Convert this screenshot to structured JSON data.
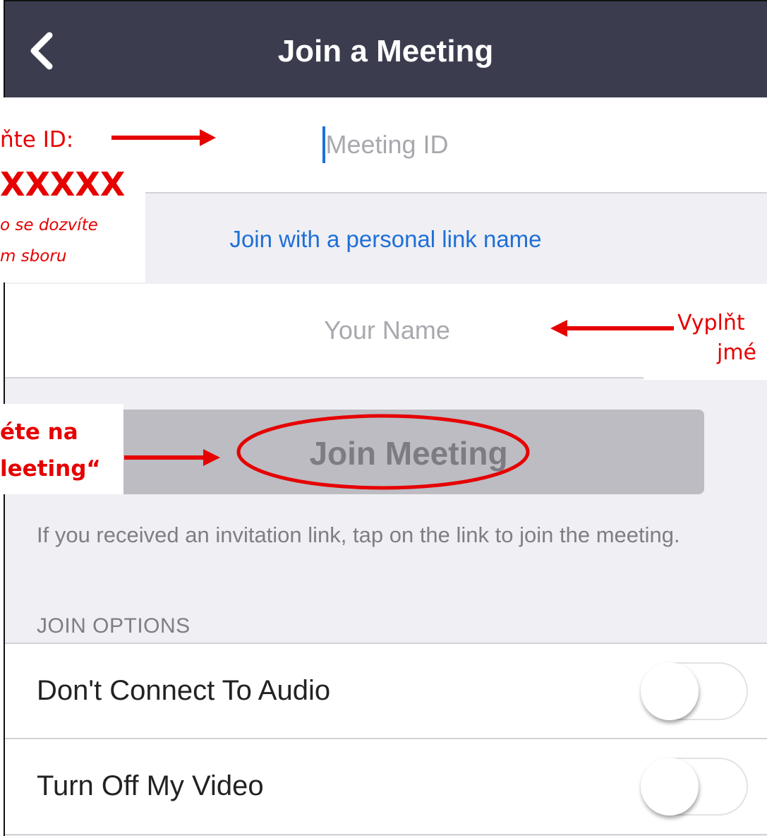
{
  "nav": {
    "title": "Join a Meeting",
    "back_icon": "chevron-left-icon"
  },
  "meeting_id": {
    "value": "",
    "placeholder": "Meeting ID"
  },
  "personal_link": {
    "label": "Join with a personal link name"
  },
  "your_name": {
    "value": "",
    "placeholder": "Your Name"
  },
  "join_button": {
    "label": "Join Meeting"
  },
  "hint": {
    "text": "If you received an invitation link, tap on the link to join the meeting."
  },
  "join_options": {
    "header": "JOIN OPTIONS",
    "items": [
      {
        "label": "Don't Connect To Audio",
        "on": false
      },
      {
        "label": "Turn Off My Video",
        "on": false
      }
    ]
  },
  "annotations": {
    "id_note": {
      "line1": "ňte ID:",
      "line2": "XXXXX",
      "line3": "o se dozvíte",
      "line4": "m sboru"
    },
    "name_note": {
      "line1": "Vyplňt",
      "line2": "jmé"
    },
    "join_note": {
      "line1": "éte na",
      "line2": "leeting“"
    },
    "color": "#e60000"
  },
  "colors": {
    "nav_bg": "#3b3d4f",
    "link_blue": "#1f6fd6",
    "caret_blue": "#1e6fd9",
    "button_bg": "#bcbcc2",
    "screen_bg": "#efeff4"
  }
}
